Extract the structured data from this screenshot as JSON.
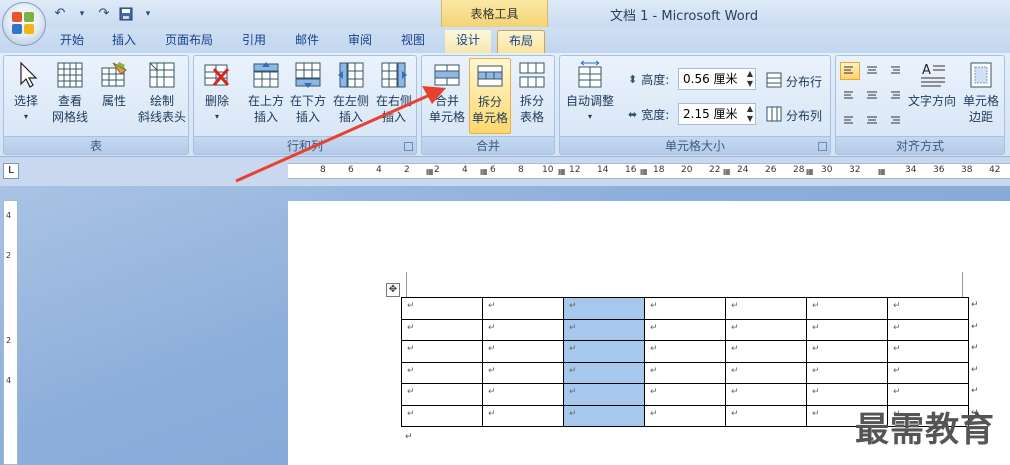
{
  "titlebar": {
    "context_tab_title": "表格工具",
    "window_title": "文档 1 - Microsoft Word"
  },
  "tabs": [
    "开始",
    "插入",
    "页面布局",
    "引用",
    "邮件",
    "审阅",
    "视图",
    "设计",
    "布局"
  ],
  "active_tab": "布局",
  "ribbon": {
    "groups": {
      "table": {
        "label": "表",
        "select": "选择",
        "view_gridlines_1": "查看",
        "view_gridlines_2": "网格线",
        "properties": "属性",
        "draw_diag_1": "绘制",
        "draw_diag_2": "斜线表头"
      },
      "rows_cols": {
        "label": "行和列",
        "delete": "删除",
        "insert_above_1": "在上方",
        "insert_above_2": "插入",
        "insert_below_1": "在下方",
        "insert_below_2": "插入",
        "insert_left_1": "在左侧",
        "insert_left_2": "插入",
        "insert_right_1": "在右侧",
        "insert_right_2": "插入"
      },
      "merge": {
        "label": "合并",
        "merge_cells_1": "合并",
        "merge_cells_2": "单元格",
        "split_cells_1": "拆分",
        "split_cells_2": "单元格",
        "split_table_1": "拆分",
        "split_table_2": "表格"
      },
      "cell_size": {
        "label": "单元格大小",
        "autofit": "自动调整",
        "height_label": "高度:",
        "height_value": "0.56 厘米",
        "width_label": "宽度:",
        "width_value": "2.15 厘米",
        "distribute_rows": "分布行",
        "distribute_cols": "分布列"
      },
      "alignment": {
        "label": "对齐方式",
        "text_direction": "文字方向",
        "cell_margins_1": "单元格",
        "cell_margins_2": "边距"
      }
    }
  },
  "ruler": {
    "corner": "L",
    "numbers": [
      "8",
      "6",
      "4",
      "2",
      "2",
      "4",
      "6",
      "8",
      "10",
      "12",
      "14",
      "16",
      "18",
      "20",
      "22",
      "24",
      "26",
      "28",
      "30",
      "32",
      "34",
      "36",
      "38",
      "40",
      "42"
    ],
    "vertical_numbers": [
      "4",
      "2",
      "2",
      "4"
    ]
  },
  "document": {
    "paragraph_mark": "↵",
    "rows": 6,
    "cols": 7,
    "selected_col": 2
  },
  "watermark": "最需教育",
  "colors": {
    "selection": "#a6c8ec",
    "arrow": "#e8412f",
    "active_tab": "#fbe39a"
  }
}
